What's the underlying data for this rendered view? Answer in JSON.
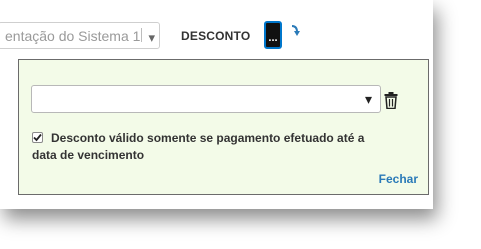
{
  "background": {
    "select_text": "entação do Sistema 1",
    "discount_label": "DESCONTO",
    "dots_button_label": "..."
  },
  "popover": {
    "select_value": "",
    "checkbox_checked": true,
    "checkbox_label": "Desconto válido somente se pagamento efetuado até a data de vencimento",
    "close_label": "Fechar"
  },
  "colors": {
    "popover_bg": "#f3fbe8",
    "link": "#2a7ab8",
    "button_border": "#0077cc"
  },
  "icons": {
    "trash": "trash-icon",
    "arrow": "curved-arrow-down-icon",
    "caret": "chevron-down-icon",
    "check": "check-icon"
  }
}
